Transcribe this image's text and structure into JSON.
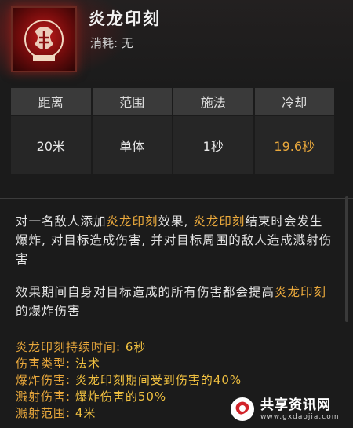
{
  "skill": {
    "name": "炎龙印刻",
    "cost_label": "消耗:",
    "cost_value": "无"
  },
  "stats": {
    "headers": [
      "距离",
      "范围",
      "施法",
      "冷却"
    ],
    "values": [
      "20米",
      "单体",
      "1秒",
      "19.6秒"
    ]
  },
  "description": {
    "p1_a": "对一名敌人添加",
    "p1_b": "炎龙印刻",
    "p1_c": "效果, ",
    "p1_d": "炎龙印刻",
    "p1_e": "结束时会发生爆炸, 对目标造成伤害, 并对目标周围的敌人造成溅射伤害",
    "p2_a": "效果期间自身对目标造成的所有伤害都会提高",
    "p2_b": "炎龙印刻",
    "p2_c": "的爆炸伤害"
  },
  "details": [
    {
      "key": "炎龙印刻持续时间:",
      "value": " 6秒"
    },
    {
      "key": "伤害类型:",
      "value": " 法术"
    },
    {
      "key": "爆炸伤害:",
      "value": " 炎龙印刻期间受到伤害的40%"
    },
    {
      "key": "溅射伤害:",
      "value": " 爆炸伤害的50%"
    },
    {
      "key": "溅射范围:",
      "value": " 4米"
    }
  ],
  "watermark": {
    "title": "共享资讯网",
    "subtitle": "www.gxdaojia.com"
  },
  "colors": {
    "highlight": "#e9a83c",
    "icon_red": "#c01a1a"
  }
}
